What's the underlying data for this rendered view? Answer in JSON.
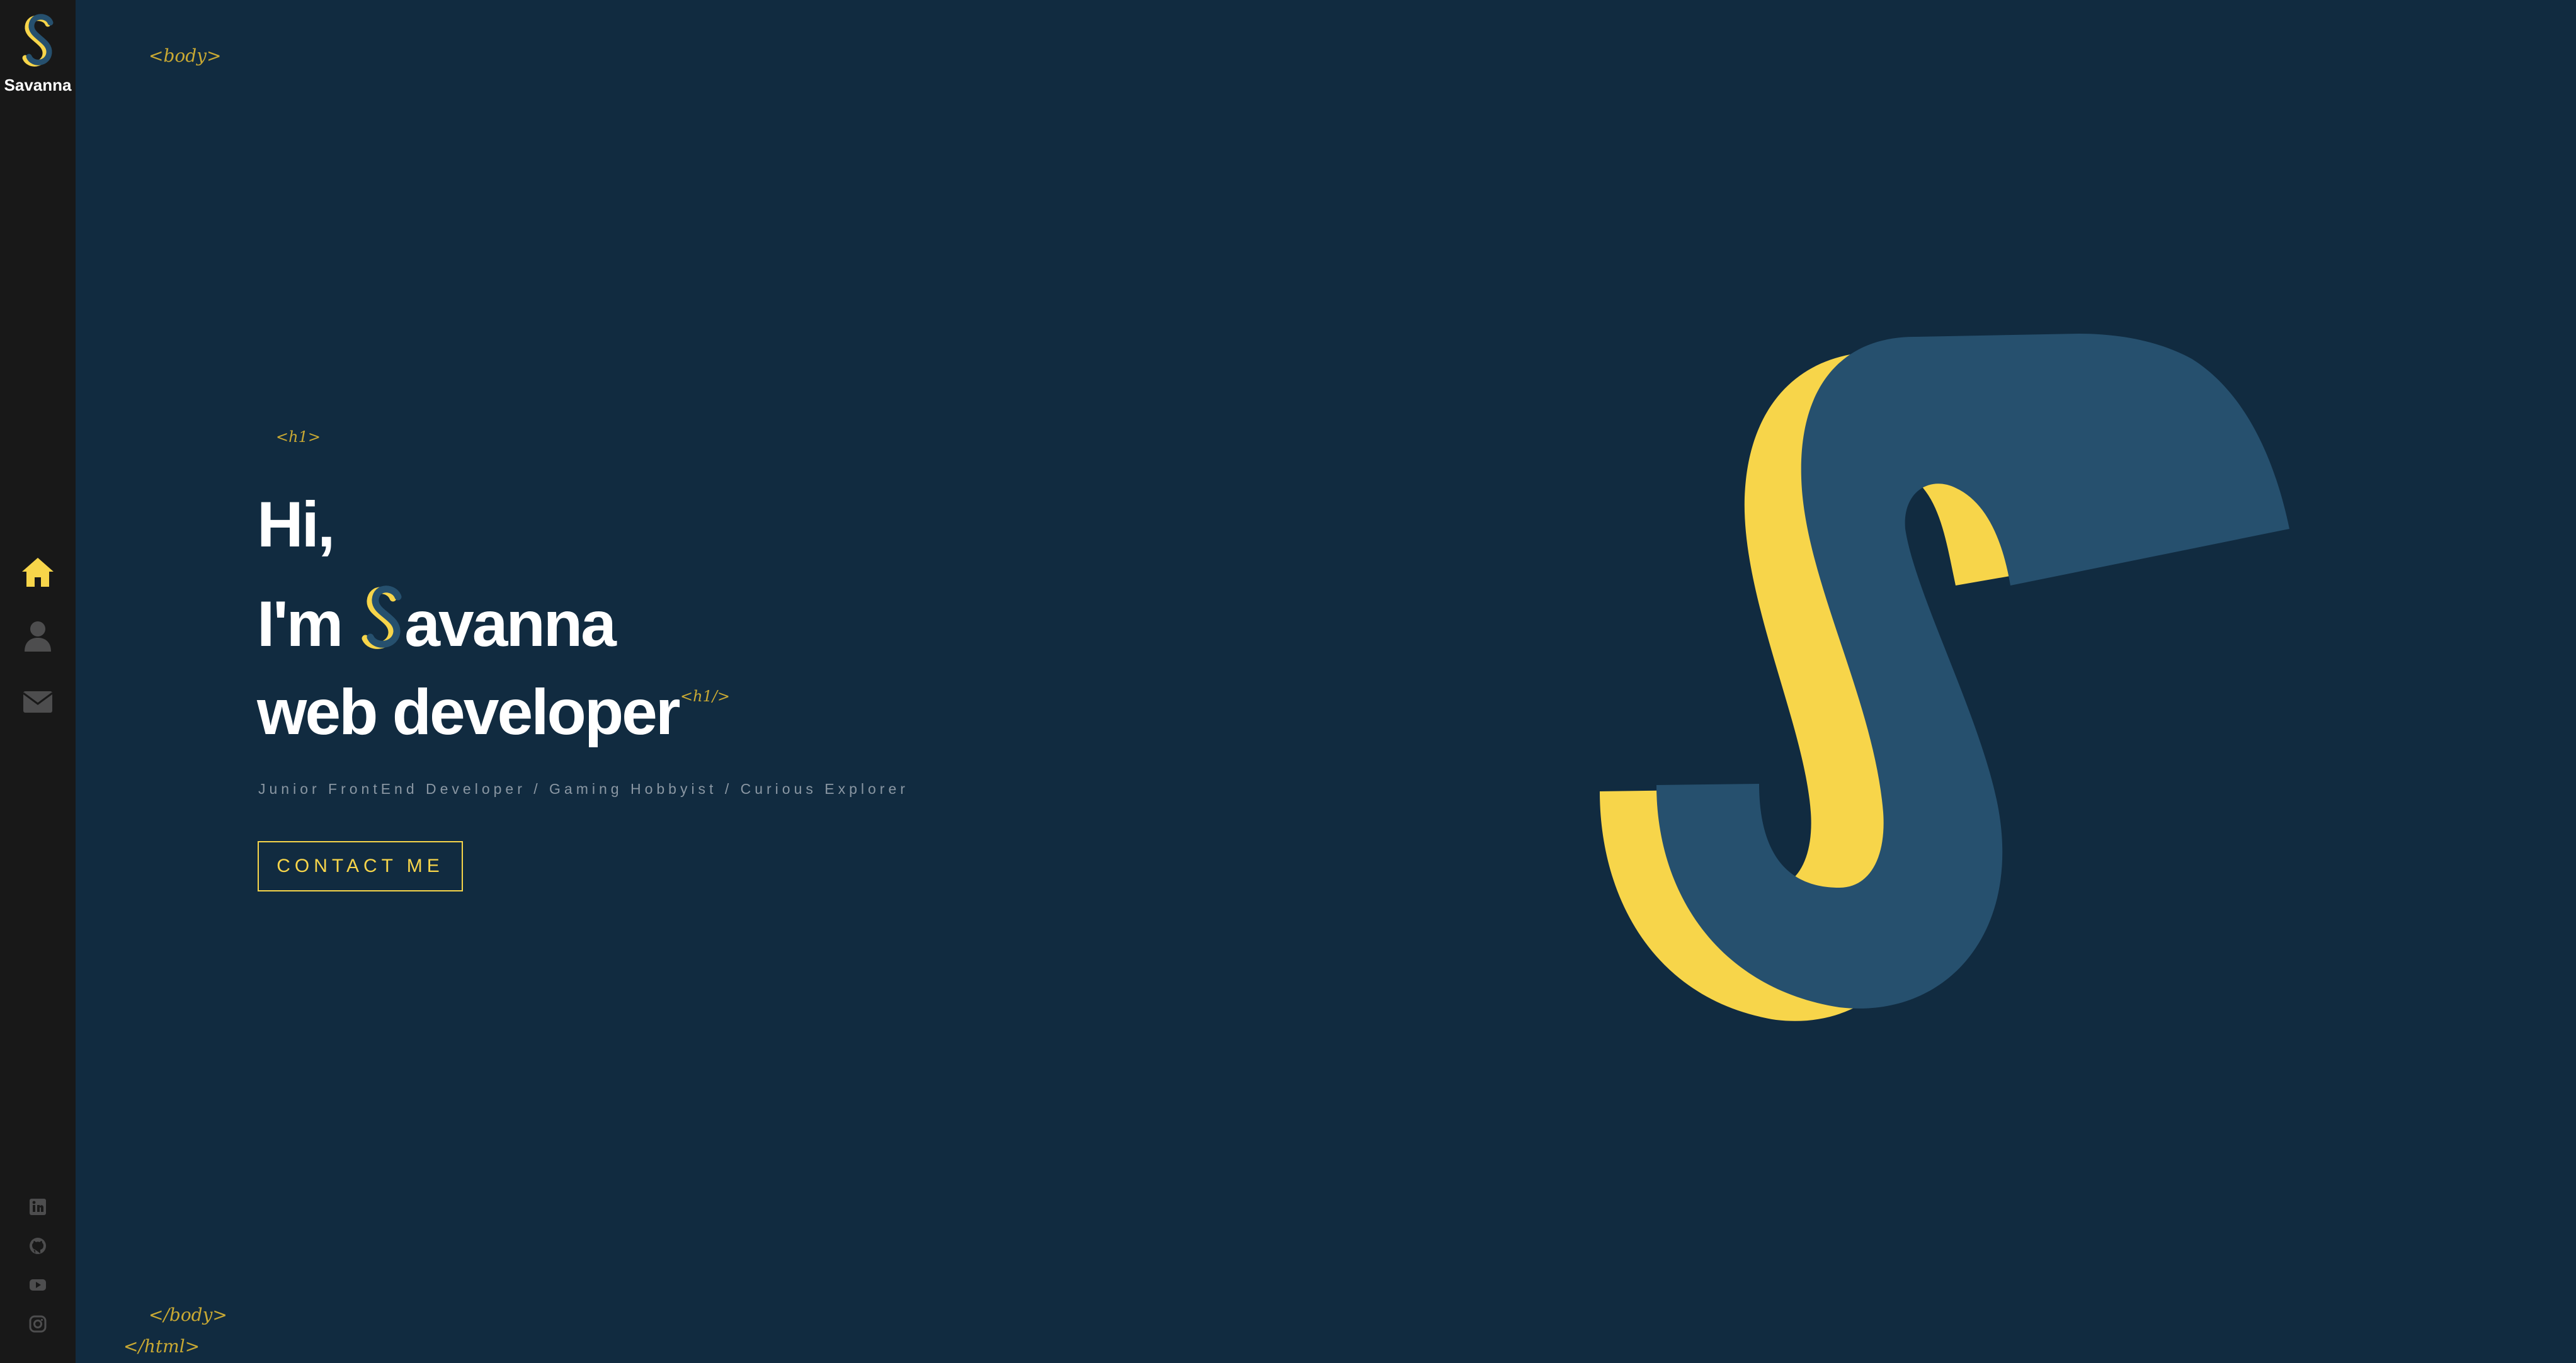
{
  "sidebar": {
    "logo_name": "Savanna",
    "nav": [
      {
        "icon": "home-icon",
        "active": true
      },
      {
        "icon": "user-icon",
        "active": false
      },
      {
        "icon": "envelope-icon",
        "active": false
      }
    ],
    "social": [
      {
        "icon": "linkedin-icon"
      },
      {
        "icon": "github-icon"
      },
      {
        "icon": "youtube-icon"
      },
      {
        "icon": "instagram-icon"
      }
    ]
  },
  "tags": {
    "body_open": "<body>",
    "h1_open": "<h1>",
    "h1_close": "<h1/>",
    "body_close": "</body>",
    "html_close": "</html>"
  },
  "hero": {
    "line1": "Hi,",
    "line2_prefix": "I'm",
    "line2_name_rest": "avanna",
    "line3": "web developer",
    "subtitle": "Junior FrontEnd Developer / Gaming Hobbyist / Curious Explorer",
    "contact_label": "CONTACT ME"
  },
  "colors": {
    "background": "#112b40",
    "sidebar": "#181818",
    "accent_yellow": "#f7d54a",
    "s_blue": "#26506e",
    "icon_gray": "#4d4d4e"
  }
}
